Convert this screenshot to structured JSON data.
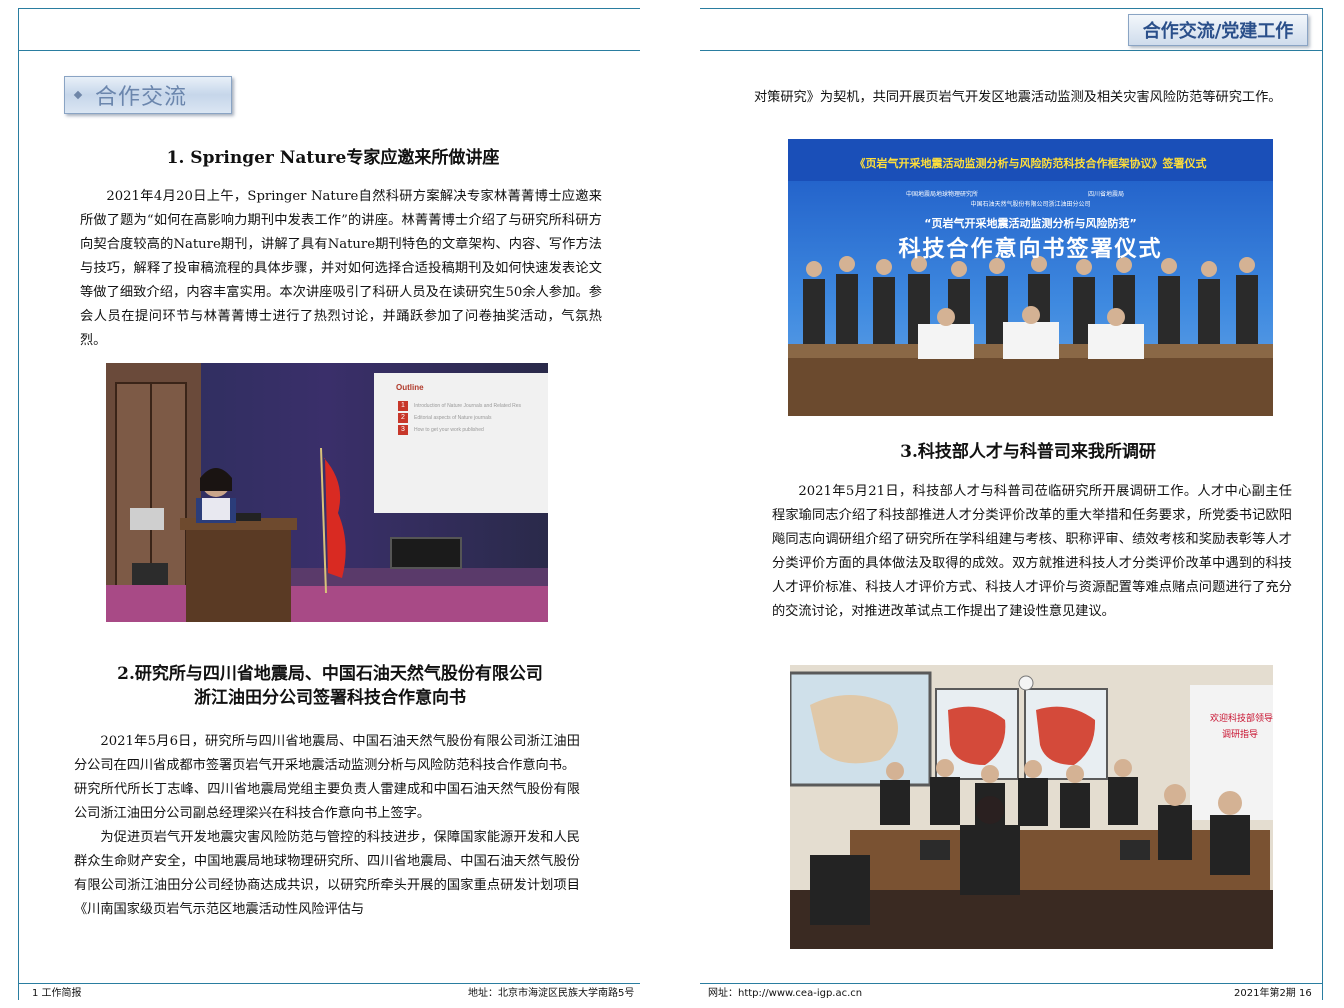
{
  "header": {
    "tab_label": "合作交流/党建工作"
  },
  "section": {
    "title": "合作交流"
  },
  "article1": {
    "title": "1. Springer Nature专家应邀来所做讲座",
    "paragraph": "2021年4月20日上午，Springer Nature自然科研方案解决专家林菁菁博士应邀来所做了题为“如何在高影响力期刊中发表工作”的讲座。林菁菁博士介绍了与研究所科研方向契合度较高的Nature期刊，讲解了具有Nature期刊特色的文章架构、内容、写作方法与技巧，解释了投审稿流程的具体步骤，并对如何选择合适投稿期刊及如何快速发表论文等做了细致介绍，内容丰富实用。本次讲座吸引了科研人员及在读研究生50余人参加。参会人员在提问环节与林菁菁博士进行了热烈讨论，并踊跃参加了问卷抽奖活动，气氛热烈。",
    "photo_slide": {
      "heading": "Outline",
      "items": [
        {
          "num": "1",
          "text": "Introduction of Nature Journals and Related Res"
        },
        {
          "num": "2",
          "text": "Editorial aspects of Nature journals"
        },
        {
          "num": "3",
          "text": "How to get your work published"
        }
      ]
    }
  },
  "article2": {
    "title_line1": "2.研究所与四川省地震局、中国石油天然气股份有限公司",
    "title_line2": "浙江油田分公司签署科技合作意向书",
    "p1": "2021年5月6日，研究所与四川省地震局、中国石油天然气股份有限公司浙江油田分公司在四川省成都市签署页岩气开采地震活动监测分析与风险防范科技合作意向书。",
    "p2": "研究所代所长丁志峰、四川省地震局党组主要负责人雷建成和中国石油天然气股份有限公司浙江油田分公司副总经理梁兴在科技合作意向书上签字。",
    "p3": "为促进页岩气开发地震灾害风险防范与管控的科技进步，保障国家能源开发和人民群众生命财产安全，中国地震局地球物理研究所、四川省地震局、中国石油天然气股份有限公司浙江油田分公司经协商达成共识，以研究所牵头开展的国家重点研发计划项目《川南国家级页岩气示范区地震活动性风险评估与",
    "continued": "对策研究》为契机，共同开展页岩气开发区地震活动监测及相关灾害风险防范等研究工作。",
    "photo_banner": {
      "top_line": "《页岩气开采地震活动监测分析与风险防范科技合作框架协议》签署仪式",
      "orgs_row1_left": "中国地震局地球物理研究所",
      "orgs_row1_right": "四川省地震局",
      "orgs_row2": "中国石油天然气股份有限公司浙江油田分公司",
      "subtitle": "“页岩气开采地震活动监测分析与风险防范”",
      "main": "科技合作意向书签署仪式"
    }
  },
  "article3": {
    "title": "3.科技部人才与科普司来我所调研",
    "paragraph": "2021年5月21日，科技部人才与科普司莅临研究所开展调研工作。人才中心副主任程家瑜同志介绍了科技部推进人才分类评价改革的重大举措和任务要求，所党委书记欧阳飚同志向调研组介绍了研究所在学科组建与考核、职称评审、绩效考核和奖励表彰等人才分类评价方面的具体做法及取得的成效。双方就推进科技人才分类评价改革中遇到的科技人才评价标准、科技人才评价方式、科技人才评价与资源配置等难点赌点问题进行了充分的交流讨论，对推进改革试点工作提出了建设性意见建议。",
    "photo_screen_line1": "欢迎科技部领导",
    "photo_screen_line2": "调研指导"
  },
  "footer": {
    "left_page": "1  工作简报",
    "left_address": "地址：北京市海淀区民族大学南路5号",
    "right_site": "网址：http://www.cea-igp.ac.cn",
    "right_issue": "2021年第2期  16"
  },
  "colors": {
    "frame": "#2a7da0",
    "badge_text": "#6b86ad",
    "tab_text": "#2a4f8a",
    "banner_red": "#c8102e",
    "banner_blue": "#1f6fc8"
  }
}
